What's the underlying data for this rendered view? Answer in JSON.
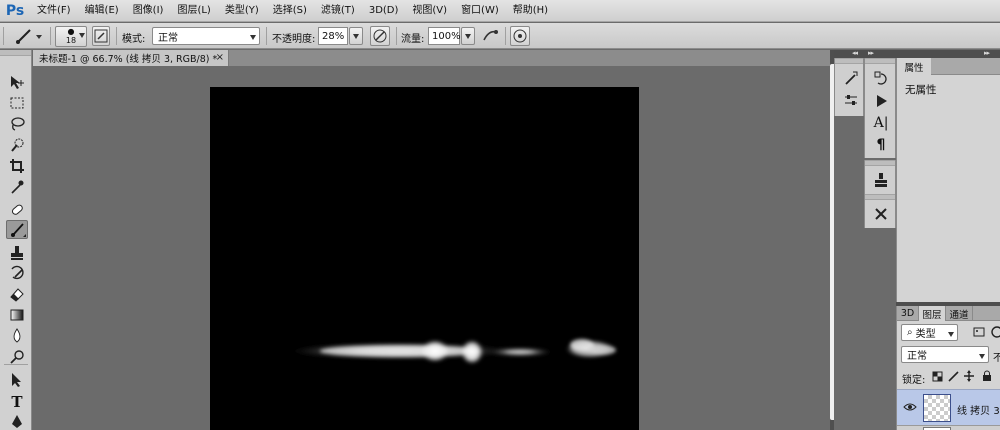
{
  "app": {
    "logo": "Ps"
  },
  "menu": [
    "文件(F)",
    "编辑(E)",
    "图像(I)",
    "图层(L)",
    "类型(Y)",
    "选择(S)",
    "滤镜(T)",
    "3D(D)",
    "视图(V)",
    "窗口(W)",
    "帮助(H)"
  ],
  "options": {
    "brush_size": "18",
    "mode_label": "模式:",
    "mode_value": "正常",
    "opacity_label": "不透明度:",
    "opacity_value": "28%",
    "flow_label": "流量:",
    "flow_value": "100%"
  },
  "document": {
    "tab_title": "未标题-1 @ 66.7% (线 拷贝 3, RGB/8) *",
    "close_glyph": "×"
  },
  "properties": {
    "tab": "属性",
    "content": "无属性"
  },
  "layers": {
    "tabs": [
      "3D",
      "图层",
      "通道"
    ],
    "filter_value": "类型",
    "blend_value": "正常",
    "opacity_short": "不",
    "lock_label": "锁定:",
    "layer_name": "线 拷贝 3"
  },
  "icons": {
    "tools": [
      "move-icon",
      "marquee-icon",
      "lasso-icon",
      "quick-select-icon",
      "crop-icon",
      "eyedropper-icon",
      "healing-brush-icon",
      "brush-icon",
      "stamp-icon",
      "history-brush-icon",
      "eraser-icon",
      "gradient-icon",
      "blur-icon",
      "dodge-icon",
      "path-select-icon",
      "type-icon",
      "pen-icon"
    ]
  },
  "colors": {
    "accent": "#1d66b5",
    "layer_selected": "#b9c8e8"
  }
}
